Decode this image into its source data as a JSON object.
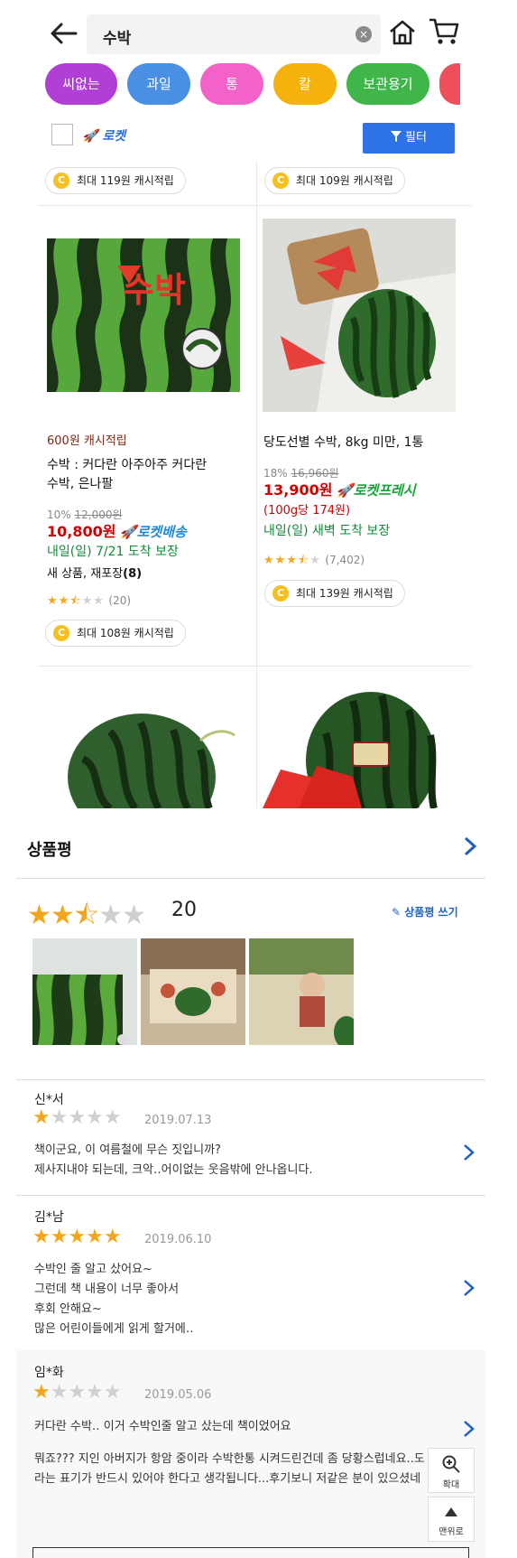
{
  "header": {
    "query": "수박",
    "clear_icon": "×"
  },
  "chips": [
    {
      "label": "씨없는",
      "color": "#b13fd6",
      "w": 80
    },
    {
      "label": "과일",
      "color": "#4a90e2",
      "w": 70
    },
    {
      "label": "통",
      "color": "#f262c8",
      "w": 70
    },
    {
      "label": "칼",
      "color": "#f5b20a",
      "w": 70
    },
    {
      "label": "보관용기",
      "color": "#3fb54a",
      "w": 92
    },
    {
      "label": "",
      "color": "#ef4f5a",
      "w": 40
    }
  ],
  "filter": {
    "rocket_label": "로켓",
    "filter_label": "필터"
  },
  "top_cash": {
    "left": "최대 119원 캐시적립",
    "right": "최대 109원 캐시적립"
  },
  "product1": {
    "img_text": "수박",
    "cash_badge": "600원 캐시적립",
    "title_line1": "수박 : 커다란 아주아주 커다란",
    "title_line2": "수박, 은나팔",
    "discount": "10%",
    "orig_price": "12,000원",
    "price": "10,800원",
    "rocket": "로켓배송",
    "delivery": "내일(일) 7/21 도착 보장",
    "condition": "새 상품, 재포장",
    "condition_count": "(8)",
    "stars": "★★★☆☆",
    "review_count": "(20)",
    "cash": "최대 108원 캐시적립"
  },
  "product2": {
    "title": "당도선별 수박, 8kg 미만, 1통",
    "discount": "18%",
    "orig_price": "16,960원",
    "price": "13,900원",
    "rocket": "로켓프레시",
    "unit_price": "(100g당 174원)",
    "delivery": "내일(일) 새벽 도착 보장",
    "stars": "★★★★☆",
    "review_count": "(7,402)",
    "cash": "최대 139원 캐시적립"
  },
  "reviews": {
    "title": "상품평",
    "count": "20",
    "write_label": "상품평 쓰기",
    "items": [
      {
        "name": "신*서",
        "rating": 1,
        "date": "2019.07.13",
        "lines": [
          "책이군요, 이 여름철에 무슨 짓입니까?",
          "제사지내야 되는데, 크악‥어이없는 웃음밖에 안나옵니다."
        ]
      },
      {
        "name": "김*남",
        "rating": 5,
        "date": "2019.06.10",
        "lines": [
          "수박인 줄 알고 샀어요~",
          "그런데 책 내용이 너무 좋아서",
          "후회 안해요~",
          "많은 어린이들에게 읽게 할거에‥"
        ]
      },
      {
        "name": "임*화",
        "rating": 1,
        "date": "2019.05.06",
        "lines": [
          "커다란 수박‥ 이거 수박인줄 알고 샀는데 책이었어요",
          "",
          "뭐죠??? 지인 아버지가 항암 중이라 수박한통 시켜드린건데 좀 당황스럽네요..도",
          "라는 표기가 반드시 있어야 한다고 생각됩니다...후기보니 저같은 분이 있으셨네"
        ]
      }
    ]
  },
  "side": {
    "zoom_label": "확대",
    "top_label": "맨위로"
  },
  "colors": {
    "accent": "#2e73e6",
    "star": "#f2a61c",
    "star_off": "#d0d0d0",
    "price_red": "#c00000"
  }
}
